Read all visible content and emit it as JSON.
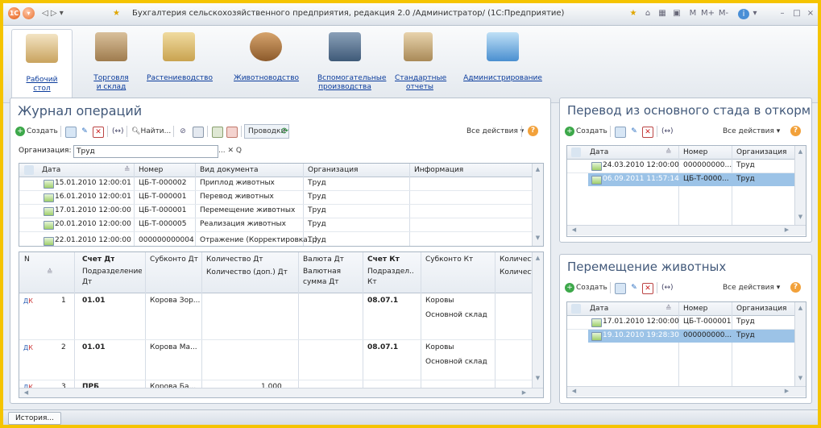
{
  "window": {
    "title": "Бухгалтерия сельскохозяйственного предприятия, редакция 2.0 /Администратор/  (1С:Предприятие)",
    "logo": "1С",
    "right_icons": [
      "star-icon",
      "home-icon",
      "calc-icon",
      "calendar-icon"
    ],
    "memory_buttons": [
      "M",
      "M+",
      "M-"
    ],
    "info_icon": "i",
    "minimize": "–",
    "close": "×"
  },
  "sections": [
    {
      "label": "Рабочий стол",
      "icon": "desk-icon"
    },
    {
      "label": "Торговля и склад",
      "icon": "boxes-icon"
    },
    {
      "label": "Растениеводство",
      "icon": "wheat-icon"
    },
    {
      "label": "Животноводство",
      "icon": "cow-icon"
    },
    {
      "label": "Вспомогательные производства",
      "icon": "tractor-icon"
    },
    {
      "label": "Стандартные отчеты",
      "icon": "reports-icon"
    },
    {
      "label": "Администрирование",
      "icon": "computer-icon"
    }
  ],
  "journal": {
    "title": "Журнал операций",
    "toolbar": {
      "create": "Создать",
      "find": "Найти...",
      "postings": "Проводки",
      "all_actions": "Все действия ▾",
      "help": "?"
    },
    "org_label": "Организация:",
    "org_value": "Труд",
    "org_buttons": "... ✕ Q",
    "columns": [
      "Дата",
      "Номер",
      "Вид документа",
      "Организация",
      "Информация"
    ],
    "rows": [
      {
        "date": "15.01.2010 12:00:01",
        "number": "ЦБ-Т-000002",
        "doc": "Приплод животных",
        "org": "Труд"
      },
      {
        "date": "16.01.2010 12:00:01",
        "number": "ЦБ-Т-000001",
        "doc": "Перевод животных",
        "org": "Труд"
      },
      {
        "date": "17.01.2010 12:00:00",
        "number": "ЦБ-Т-000001",
        "doc": "Перемещение животных",
        "org": "Труд"
      },
      {
        "date": "20.01.2010 12:00:00",
        "number": "ЦБ-Т-000005",
        "doc": "Реализация животных",
        "org": "Труд"
      },
      {
        "date": "22.01.2010 12:00:00",
        "number": "000000000004",
        "doc": "Отражение (Корректировка...)",
        "org": "Труд"
      }
    ]
  },
  "postings": {
    "header_row1": [
      "N",
      "Счет Дт",
      "Субконто Дт",
      "Количество Дт",
      "Валюта Дт",
      "Счет Кт",
      "Субконто Кт",
      "Количест"
    ],
    "header_row2": [
      "Подразделение Дт",
      "Количество (доп.) Дт",
      "Валютная сумма Дт",
      "Подраздел... Кт",
      "Количест"
    ],
    "rows": [
      {
        "n": "1",
        "account_dt": "01.01",
        "subconto_dt": "Корова Зор...",
        "account_kt": "08.07.1",
        "subconto_kt": [
          "Коровы",
          "Основной склад"
        ]
      },
      {
        "n": "2",
        "account_dt": "01.01",
        "subconto_dt": "Корова Ма...",
        "account_kt": "08.07.1",
        "subconto_kt": [
          "Коровы",
          "Основной склад"
        ]
      },
      {
        "n": "3",
        "account_dt": "ПРБ",
        "subconto_dt": "Корова Ба...",
        "qty": "1.000",
        "account_kt": "",
        "subconto_kt": [
          "",
          ""
        ]
      }
    ]
  },
  "transfer_panel": {
    "title": "Перевод из основного стада в откорм",
    "toolbar": {
      "create": "Создать",
      "all_actions": "Все действия ▾",
      "help": "?"
    },
    "columns": [
      "Дата",
      "Номер",
      "Организация"
    ],
    "rows": [
      {
        "date": "24.03.2010 12:00:00",
        "number": "000000000...",
        "org": "Труд",
        "selected": false
      },
      {
        "date": "06.09.2011 11:57:14",
        "number": "ЦБ-Т-0000...",
        "org": "Труд",
        "selected": true
      }
    ]
  },
  "move_panel": {
    "title": "Перемещение животных",
    "toolbar": {
      "create": "Создать",
      "all_actions": "Все действия ▾",
      "help": "?"
    },
    "columns": [
      "Дата",
      "Номер",
      "Организация"
    ],
    "rows": [
      {
        "date": "17.01.2010 12:00:00",
        "number": "ЦБ-Т-000001",
        "org": "Труд",
        "selected": false
      },
      {
        "date": "19.10.2010 19:28:30",
        "number": "000000000...",
        "org": "Труд",
        "selected": true
      }
    ]
  },
  "bottom": {
    "history": "История..."
  },
  "colors": {
    "frame": "#f5c400",
    "title_blue": "#42597a",
    "link_blue": "#0b3c9c",
    "selection": "#9cc3e7"
  }
}
